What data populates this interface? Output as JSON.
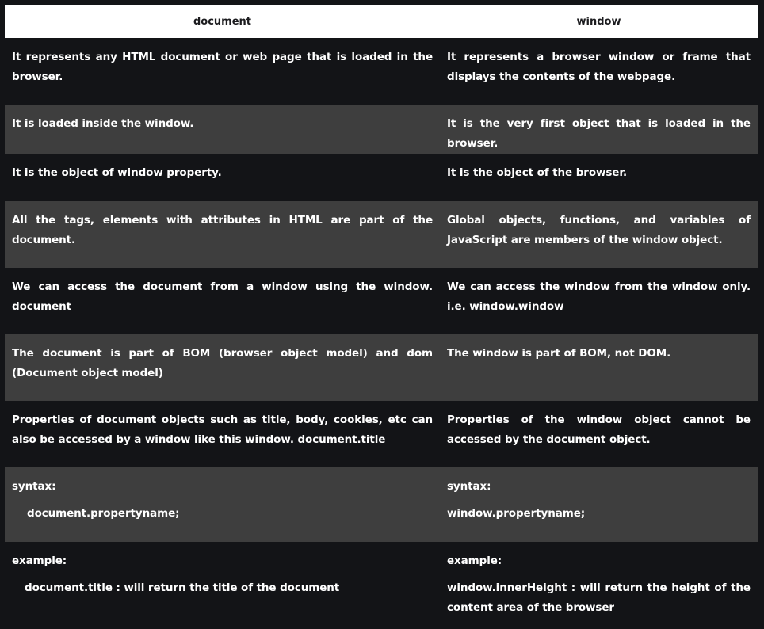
{
  "table": {
    "headers": [
      "document",
      "window"
    ],
    "rows": [
      {
        "document": "It represents any HTML document or web page that is loaded in the browser.",
        "window": "It represents a browser window or frame that displays the contents of the webpage."
      },
      {
        "document": "It is loaded inside the window.",
        "window": "It is the very first object that is loaded in the browser."
      },
      {
        "document": "It is the object of window property.",
        "window": "It is the object of the browser."
      },
      {
        "document": "All the tags, elements with attributes in HTML are part of the document.",
        "window": "Global objects, functions, and variables of JavaScript are members of the window object."
      },
      {
        "document": "We can access the document from a window using the window. document",
        "window": "We can access the window from the window only. i.e. window.window"
      },
      {
        "document": "The document is part of BOM (browser object model) and dom (Document object model)",
        "window": "The window is part of BOM, not DOM."
      },
      {
        "document": "Properties of document objects such as title, body, cookies, etc can also be accessed by a window like this window. document.title",
        "window": "Properties of the window object cannot be accessed by the document object."
      }
    ],
    "syntax": {
      "label": "syntax:",
      "document_code": "document.propertyname;",
      "window_code": "window.propertyname;"
    },
    "example": {
      "label": "example:",
      "document_code": "document.title :  will return the title of the document",
      "window_code": "window.innerHeight : will return the height of the content area of the browser"
    }
  }
}
